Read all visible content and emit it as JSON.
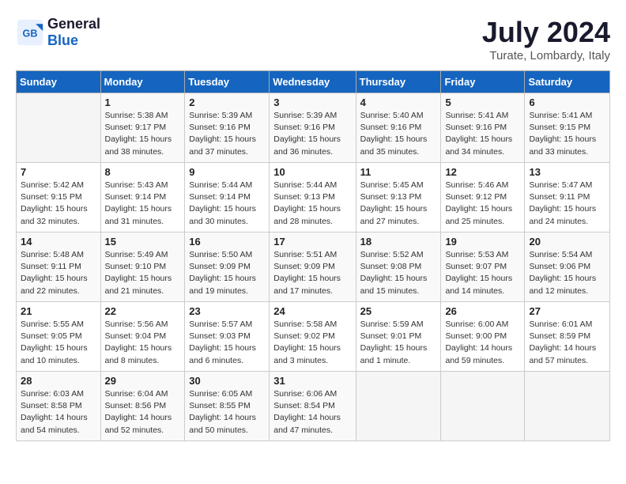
{
  "header": {
    "logo_line1": "General",
    "logo_line2": "Blue",
    "month_year": "July 2024",
    "location": "Turate, Lombardy, Italy"
  },
  "days_of_week": [
    "Sunday",
    "Monday",
    "Tuesday",
    "Wednesday",
    "Thursday",
    "Friday",
    "Saturday"
  ],
  "weeks": [
    [
      {
        "day": "",
        "info": ""
      },
      {
        "day": "1",
        "info": "Sunrise: 5:38 AM\nSunset: 9:17 PM\nDaylight: 15 hours\nand 38 minutes."
      },
      {
        "day": "2",
        "info": "Sunrise: 5:39 AM\nSunset: 9:16 PM\nDaylight: 15 hours\nand 37 minutes."
      },
      {
        "day": "3",
        "info": "Sunrise: 5:39 AM\nSunset: 9:16 PM\nDaylight: 15 hours\nand 36 minutes."
      },
      {
        "day": "4",
        "info": "Sunrise: 5:40 AM\nSunset: 9:16 PM\nDaylight: 15 hours\nand 35 minutes."
      },
      {
        "day": "5",
        "info": "Sunrise: 5:41 AM\nSunset: 9:16 PM\nDaylight: 15 hours\nand 34 minutes."
      },
      {
        "day": "6",
        "info": "Sunrise: 5:41 AM\nSunset: 9:15 PM\nDaylight: 15 hours\nand 33 minutes."
      }
    ],
    [
      {
        "day": "7",
        "info": "Sunrise: 5:42 AM\nSunset: 9:15 PM\nDaylight: 15 hours\nand 32 minutes."
      },
      {
        "day": "8",
        "info": "Sunrise: 5:43 AM\nSunset: 9:14 PM\nDaylight: 15 hours\nand 31 minutes."
      },
      {
        "day": "9",
        "info": "Sunrise: 5:44 AM\nSunset: 9:14 PM\nDaylight: 15 hours\nand 30 minutes."
      },
      {
        "day": "10",
        "info": "Sunrise: 5:44 AM\nSunset: 9:13 PM\nDaylight: 15 hours\nand 28 minutes."
      },
      {
        "day": "11",
        "info": "Sunrise: 5:45 AM\nSunset: 9:13 PM\nDaylight: 15 hours\nand 27 minutes."
      },
      {
        "day": "12",
        "info": "Sunrise: 5:46 AM\nSunset: 9:12 PM\nDaylight: 15 hours\nand 25 minutes."
      },
      {
        "day": "13",
        "info": "Sunrise: 5:47 AM\nSunset: 9:11 PM\nDaylight: 15 hours\nand 24 minutes."
      }
    ],
    [
      {
        "day": "14",
        "info": "Sunrise: 5:48 AM\nSunset: 9:11 PM\nDaylight: 15 hours\nand 22 minutes."
      },
      {
        "day": "15",
        "info": "Sunrise: 5:49 AM\nSunset: 9:10 PM\nDaylight: 15 hours\nand 21 minutes."
      },
      {
        "day": "16",
        "info": "Sunrise: 5:50 AM\nSunset: 9:09 PM\nDaylight: 15 hours\nand 19 minutes."
      },
      {
        "day": "17",
        "info": "Sunrise: 5:51 AM\nSunset: 9:09 PM\nDaylight: 15 hours\nand 17 minutes."
      },
      {
        "day": "18",
        "info": "Sunrise: 5:52 AM\nSunset: 9:08 PM\nDaylight: 15 hours\nand 15 minutes."
      },
      {
        "day": "19",
        "info": "Sunrise: 5:53 AM\nSunset: 9:07 PM\nDaylight: 15 hours\nand 14 minutes."
      },
      {
        "day": "20",
        "info": "Sunrise: 5:54 AM\nSunset: 9:06 PM\nDaylight: 15 hours\nand 12 minutes."
      }
    ],
    [
      {
        "day": "21",
        "info": "Sunrise: 5:55 AM\nSunset: 9:05 PM\nDaylight: 15 hours\nand 10 minutes."
      },
      {
        "day": "22",
        "info": "Sunrise: 5:56 AM\nSunset: 9:04 PM\nDaylight: 15 hours\nand 8 minutes."
      },
      {
        "day": "23",
        "info": "Sunrise: 5:57 AM\nSunset: 9:03 PM\nDaylight: 15 hours\nand 6 minutes."
      },
      {
        "day": "24",
        "info": "Sunrise: 5:58 AM\nSunset: 9:02 PM\nDaylight: 15 hours\nand 3 minutes."
      },
      {
        "day": "25",
        "info": "Sunrise: 5:59 AM\nSunset: 9:01 PM\nDaylight: 15 hours\nand 1 minute."
      },
      {
        "day": "26",
        "info": "Sunrise: 6:00 AM\nSunset: 9:00 PM\nDaylight: 14 hours\nand 59 minutes."
      },
      {
        "day": "27",
        "info": "Sunrise: 6:01 AM\nSunset: 8:59 PM\nDaylight: 14 hours\nand 57 minutes."
      }
    ],
    [
      {
        "day": "28",
        "info": "Sunrise: 6:03 AM\nSunset: 8:58 PM\nDaylight: 14 hours\nand 54 minutes."
      },
      {
        "day": "29",
        "info": "Sunrise: 6:04 AM\nSunset: 8:56 PM\nDaylight: 14 hours\nand 52 minutes."
      },
      {
        "day": "30",
        "info": "Sunrise: 6:05 AM\nSunset: 8:55 PM\nDaylight: 14 hours\nand 50 minutes."
      },
      {
        "day": "31",
        "info": "Sunrise: 6:06 AM\nSunset: 8:54 PM\nDaylight: 14 hours\nand 47 minutes."
      },
      {
        "day": "",
        "info": ""
      },
      {
        "day": "",
        "info": ""
      },
      {
        "day": "",
        "info": ""
      }
    ]
  ]
}
